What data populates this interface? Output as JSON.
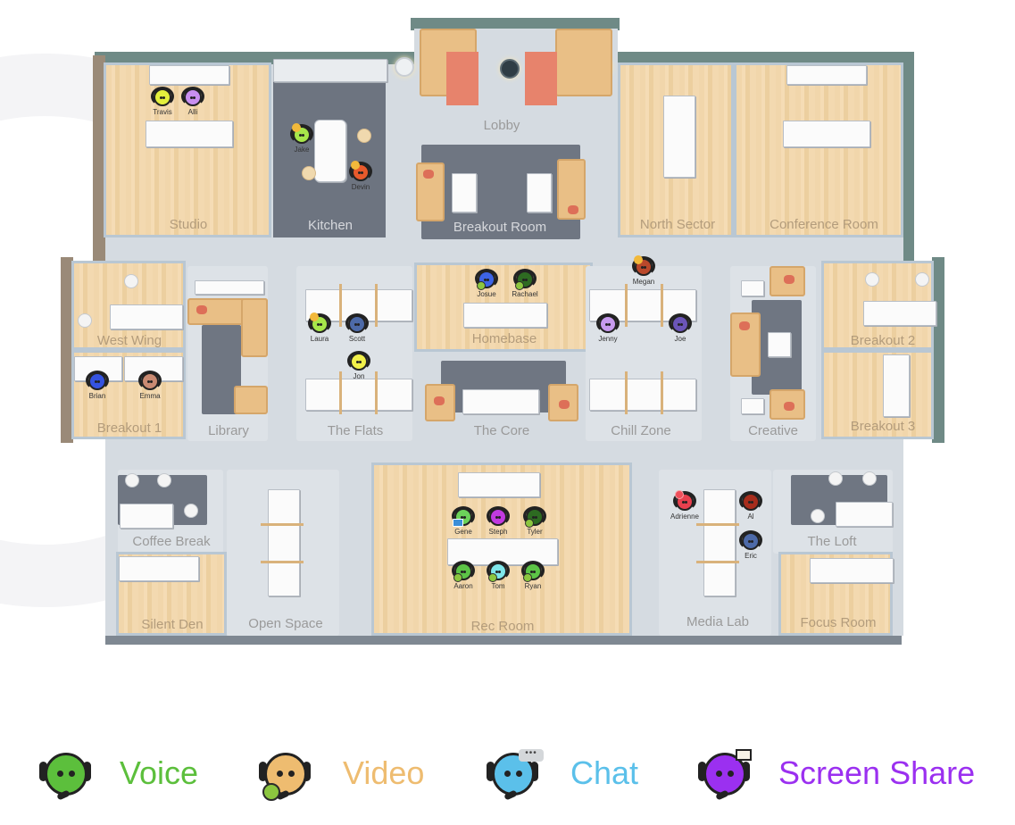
{
  "rooms": {
    "studio": "Studio",
    "kitchen": "Kitchen",
    "lobby": "Lobby",
    "breakout_room": "Breakout Room",
    "north_sector": "North Sector",
    "conference_room": "Conference Room",
    "west_wing": "West Wing",
    "breakout_1": "Breakout 1",
    "library": "Library",
    "the_flats": "The Flats",
    "homebase": "Homebase",
    "the_core": "The Core",
    "chill_zone": "Chill Zone",
    "creative": "Creative",
    "breakout_2": "Breakout 2",
    "breakout_3": "Breakout 3",
    "coffee_break": "Coffee Break",
    "silent_den": "Silent Den",
    "open_space": "Open Space",
    "rec_room": "Rec Room",
    "media_lab": "Media Lab",
    "the_loft": "The Loft",
    "focus_room": "Focus Room"
  },
  "people": [
    {
      "name": "Travis",
      "room": "Studio",
      "color": "#e3ef3d",
      "status": "voice"
    },
    {
      "name": "Alli",
      "room": "Studio",
      "color": "#c98ff0",
      "status": "voice"
    },
    {
      "name": "Jake",
      "room": "Kitchen",
      "color": "#a7e64a",
      "status": "away"
    },
    {
      "name": "Devin",
      "room": "Kitchen",
      "color": "#e85a2c",
      "status": "away"
    },
    {
      "name": "Josue",
      "room": "Homebase",
      "color": "#3d64e6",
      "status": "video"
    },
    {
      "name": "Rachael",
      "room": "Homebase",
      "color": "#2e6b22",
      "status": "video"
    },
    {
      "name": "Megan",
      "room": "Chill Zone",
      "color": "#b9482b",
      "status": "away"
    },
    {
      "name": "Jenny",
      "room": "Chill Zone",
      "color": "#c79aee",
      "status": "voice"
    },
    {
      "name": "Joe",
      "room": "Chill Zone",
      "color": "#6b55b8",
      "status": "voice"
    },
    {
      "name": "Laura",
      "room": "The Flats",
      "color": "#a7e64a",
      "status": "away"
    },
    {
      "name": "Scott",
      "room": "The Flats",
      "color": "#4d6aa8",
      "status": "voice"
    },
    {
      "name": "Jon",
      "room": "The Flats",
      "color": "#f1f04a",
      "status": "voice"
    },
    {
      "name": "Brian",
      "room": "Breakout 1",
      "color": "#3553e0",
      "status": "voice"
    },
    {
      "name": "Emma",
      "room": "Breakout 1",
      "color": "#c98a72",
      "status": "voice"
    },
    {
      "name": "Gene",
      "room": "Rec Room",
      "color": "#6cd35a",
      "status": "screen"
    },
    {
      "name": "Steph",
      "room": "Rec Room",
      "color": "#c13ae0",
      "status": "voice"
    },
    {
      "name": "Tyler",
      "room": "Rec Room",
      "color": "#2d6b21",
      "status": "video"
    },
    {
      "name": "Aaron",
      "room": "Rec Room",
      "color": "#5cc446",
      "status": "video"
    },
    {
      "name": "Tom",
      "room": "Rec Room",
      "color": "#7fe6ea",
      "status": "video"
    },
    {
      "name": "Ryan",
      "room": "Rec Room",
      "color": "#5cc446",
      "status": "video"
    },
    {
      "name": "Adrienne",
      "room": "Media Lab",
      "color": "#e8404e",
      "status": "alert"
    },
    {
      "name": "Al",
      "room": "Media Lab",
      "color": "#a72d1c",
      "status": "voice"
    },
    {
      "name": "Eric",
      "room": "Media Lab",
      "color": "#4d6aa8",
      "status": "voice"
    }
  ],
  "legend": [
    {
      "label": "Voice",
      "color": "#5cbf3c",
      "face": "#5cbf3c"
    },
    {
      "label": "Video",
      "color": "#eebc70",
      "face": "#eebc70"
    },
    {
      "label": "Chat",
      "color": "#5bc0ea",
      "face": "#5bc0ea"
    },
    {
      "label": "Screen Share",
      "color": "#9b30f0",
      "face": "#9b30f0"
    }
  ]
}
